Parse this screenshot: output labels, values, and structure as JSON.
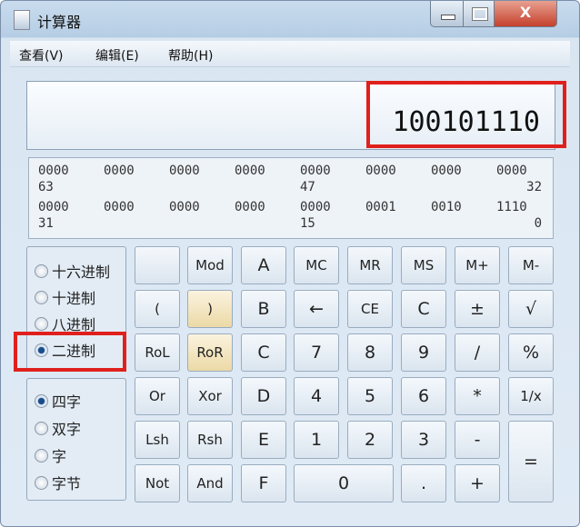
{
  "window": {
    "title": "计算器",
    "close": "X"
  },
  "menu": [
    "查看(V)",
    "编辑(E)",
    "帮助(H)"
  ],
  "display": {
    "value": "100101110"
  },
  "bits": {
    "row1": [
      "0000",
      "0000",
      "0000",
      "0000",
      "0000",
      "0000",
      "0000",
      "0000"
    ],
    "row1_labels": [
      "63",
      "47",
      "32"
    ],
    "row2": [
      "0000",
      "0000",
      "0000",
      "0000",
      "0000",
      "0001",
      "0010",
      "1110"
    ],
    "row2_labels": [
      "31",
      "15",
      "0"
    ]
  },
  "base": {
    "options": [
      "十六进制",
      "十进制",
      "八进制",
      "二进制"
    ],
    "selected": "二进制"
  },
  "word": {
    "options": [
      "四字",
      "双字",
      "字",
      "字节"
    ],
    "selected": "四字"
  },
  "keys": [
    [
      "",
      "Mod",
      "A",
      "MC",
      "MR",
      "MS",
      "M+",
      "M-"
    ],
    [
      "(",
      ")",
      "B",
      "←",
      "CE",
      "C",
      "±",
      "√"
    ],
    [
      "RoL",
      "RoR",
      "C",
      "7",
      "8",
      "9",
      "/",
      "%"
    ],
    [
      "Or",
      "Xor",
      "D",
      "4",
      "5",
      "6",
      "*",
      "1/x"
    ],
    [
      "Lsh",
      "Rsh",
      "E",
      "1",
      "2",
      "3",
      "-",
      "="
    ],
    [
      "Not",
      "And",
      "F",
      "0",
      ".",
      "+"
    ]
  ]
}
